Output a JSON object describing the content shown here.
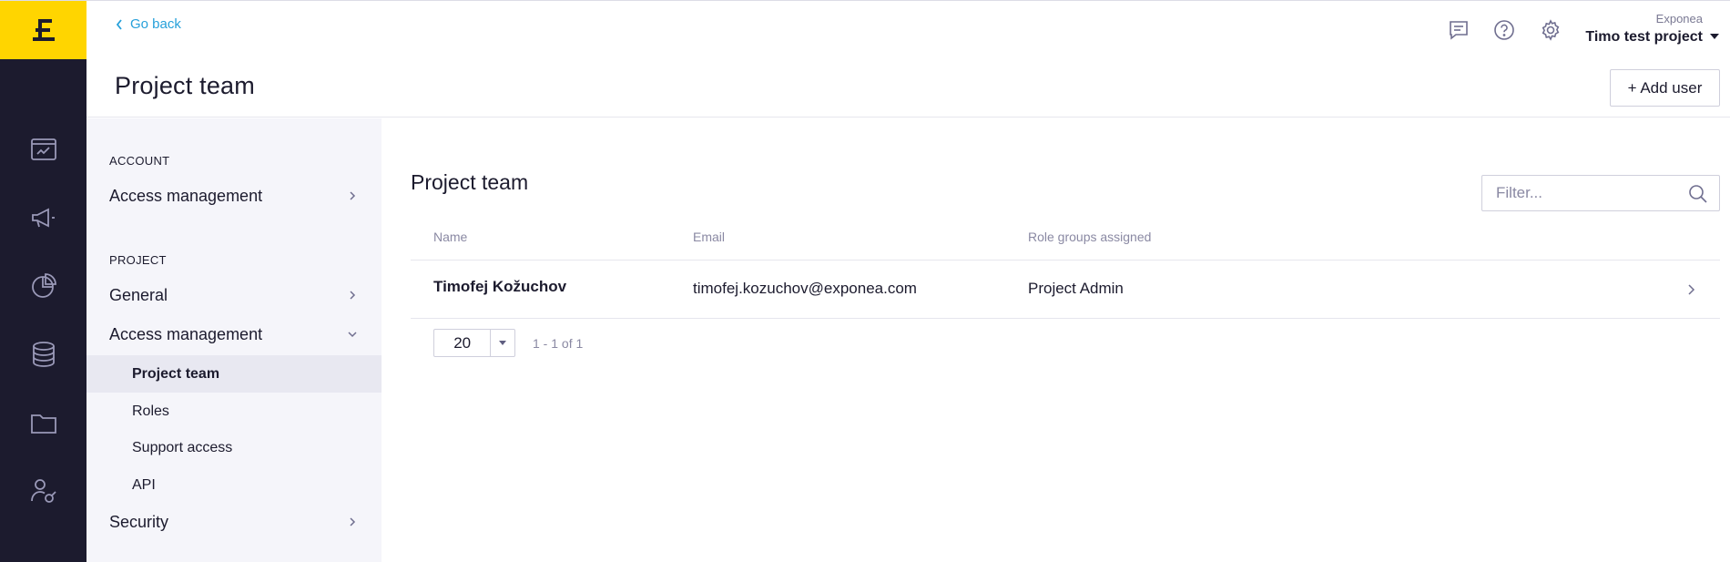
{
  "header": {
    "go_back": "Go back",
    "page_title": "Project team",
    "add_user": "+ Add user",
    "project": {
      "org": "Exponea",
      "name": "Timo test project"
    }
  },
  "rail": {
    "items": [
      "dashboard-icon",
      "campaigns-icon",
      "analyses-icon",
      "data-icon",
      "assets-icon",
      "user-settings-icon"
    ]
  },
  "sidenav": {
    "account_section": "ACCOUNT",
    "account_items": [
      {
        "label": "Access management"
      }
    ],
    "project_section": "PROJECT",
    "project_items": [
      {
        "label": "General"
      },
      {
        "label": "Access management"
      }
    ],
    "access_sub_items": [
      {
        "label": "Project team",
        "active": true
      },
      {
        "label": "Roles"
      },
      {
        "label": "Support access"
      },
      {
        "label": "API"
      }
    ],
    "security": {
      "label": "Security"
    }
  },
  "main": {
    "title": "Project team",
    "filter_placeholder": "Filter...",
    "columns": [
      "Name",
      "Email",
      "Role groups assigned"
    ],
    "rows": [
      {
        "name": "Timofej Kožuchov",
        "email": "timofej.kozuchov@exponea.com",
        "roles": "Project Admin"
      }
    ],
    "pagination": {
      "page_size": "20",
      "range": "1 - 1 of 1"
    }
  },
  "colors": {
    "brand_yellow": "#ffd500",
    "rail": "#1c1b2e",
    "link": "#26a0da"
  }
}
